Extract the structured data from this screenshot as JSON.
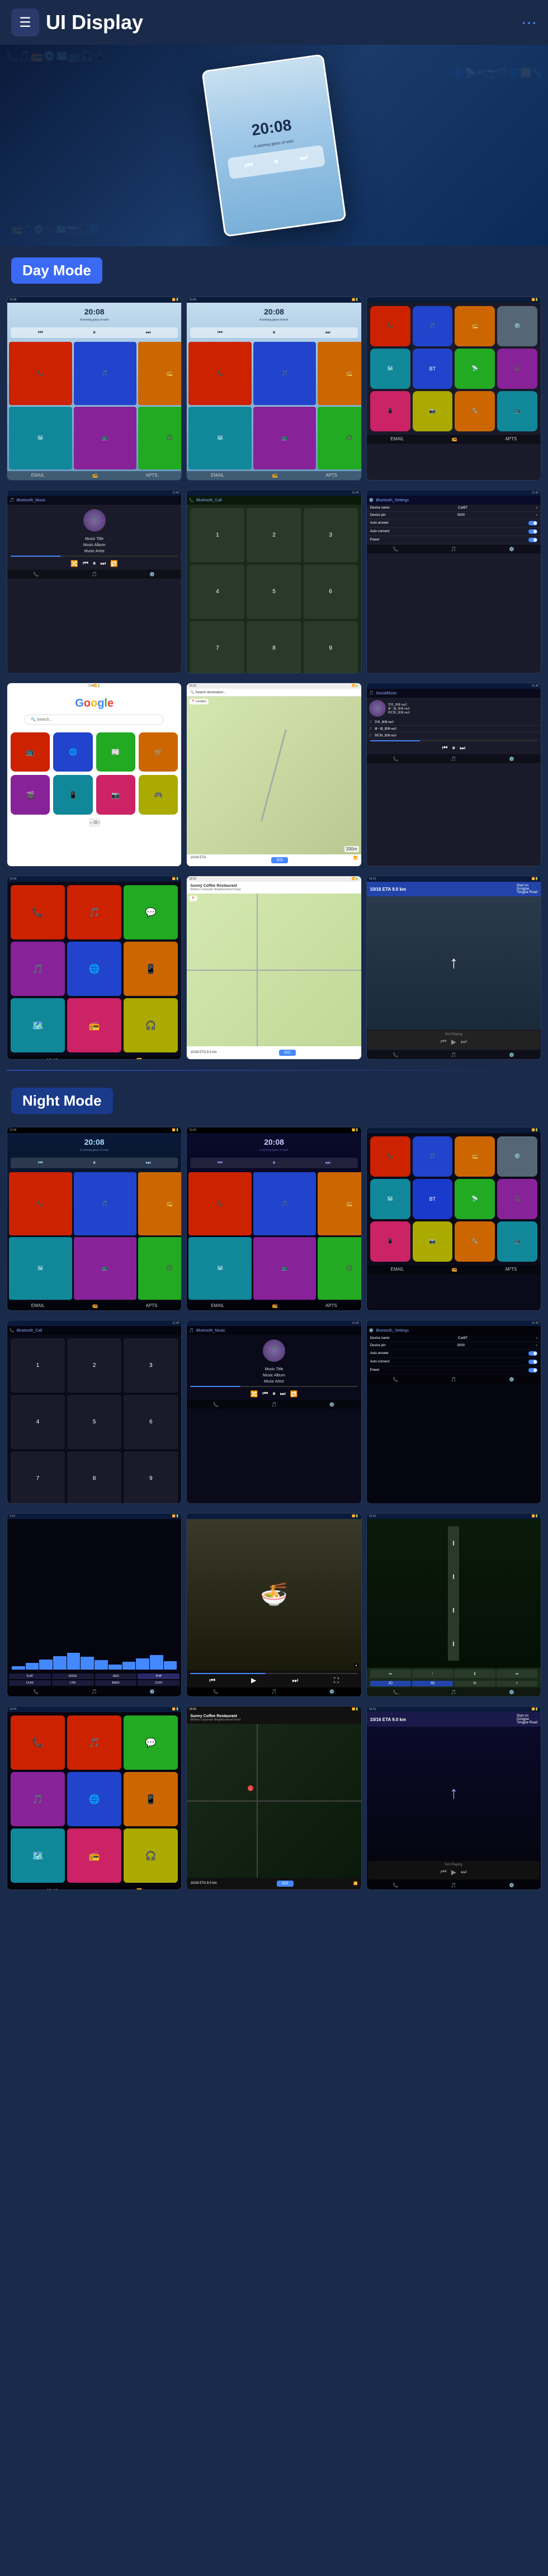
{
  "header": {
    "title": "UI Display",
    "logo_symbol": "☰",
    "menu_symbol": "≡"
  },
  "day_mode": {
    "label": "Day Mode"
  },
  "night_mode": {
    "label": "Night Mode"
  },
  "device_time": "20:08",
  "device_subtitle": "A wishing glass of wish",
  "music": {
    "title": "Music Title",
    "album": "Music Album",
    "artist": "Music Artist"
  },
  "settings": {
    "header": "Bluetooth_Settings",
    "rows": [
      {
        "label": "Device name",
        "value": "CarBT"
      },
      {
        "label": "Device pin",
        "value": "0000"
      },
      {
        "label": "Auto answer",
        "value": "toggle_on"
      },
      {
        "label": "Auto connect",
        "value": "toggle_on"
      },
      {
        "label": "Power",
        "value": "toggle_on"
      }
    ]
  },
  "navigation": {
    "coffee_shop": "Sunny Coffee Restaurant",
    "distance": "10/16 ETA",
    "start_on": "Start on Dongjue Tongjue Road",
    "go_label": "GO",
    "not_playing": "Not Playing"
  },
  "apps": {
    "icons": [
      "📞",
      "🎵",
      "📻",
      "⚙️",
      "🗺️",
      "📺",
      "🎧",
      "📱",
      "🔵",
      "📡",
      "🎮",
      "📷"
    ]
  }
}
